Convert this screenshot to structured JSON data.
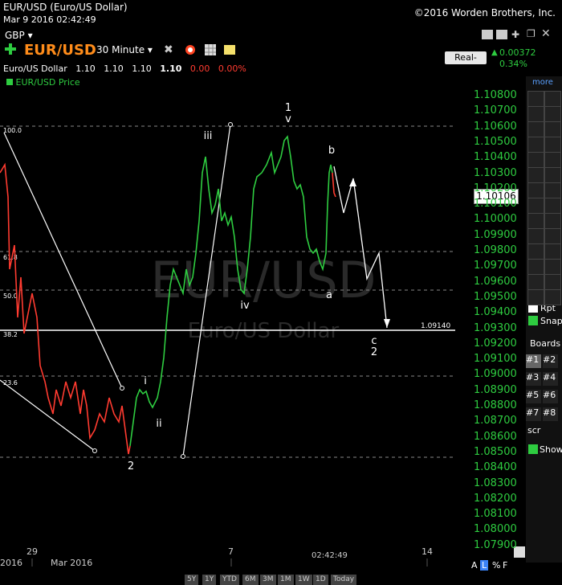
{
  "header": {
    "title": "EUR/USD (Euro/US Dollar)",
    "date": "Mar 9 2016 02:42:49",
    "copyright": "©2016 Worden Brothers, Inc.",
    "currency": "GBP"
  },
  "toolbar": {
    "symbol": "EUR/USD",
    "interval": "30 Minute",
    "icons": [
      "settings-icon",
      "clock-icon",
      "grid-icon",
      "note-icon"
    ],
    "realtime": "Real-Time",
    "change": "0.00372",
    "change_pct": "0.34%"
  },
  "quote": {
    "name": "Euro/US Dollar",
    "o": "1.10",
    "h": "1.10",
    "l": "1.10",
    "c": "1.10",
    "chg": "0.00",
    "pct": "0.00%"
  },
  "legend": {
    "price": "EUR/USD Price"
  },
  "watermark": {
    "symbol": "EUR/USD",
    "name": "Euro/US Dollar"
  },
  "fib_labels": [
    "100.0",
    "61.8",
    "50.0",
    "38.2",
    "23.6"
  ],
  "wave_labels": [
    "1",
    "v",
    "iii",
    "iv",
    "b",
    "a",
    "c",
    "2",
    "2",
    "i",
    "ii"
  ],
  "price_level": "1.09140",
  "current_price": "1.10106",
  "price_axis": [
    "1.10800",
    "1.10700",
    "1.10600",
    "1.10500",
    "1.10400",
    "1.10300",
    "1.10200",
    "1.10100",
    "1.10000",
    "1.09900",
    "1.09800",
    "1.09700",
    "1.09600",
    "1.09500",
    "1.09400",
    "1.09300",
    "1.09200",
    "1.09100",
    "1.09000",
    "1.08900",
    "1.08800",
    "1.08700",
    "1.08600",
    "1.08500",
    "1.08400",
    "1.08300",
    "1.08200",
    "1.08100",
    "1.08000",
    "1.07900"
  ],
  "x_axis": {
    "labels": [
      "2016",
      "29",
      "Mar 2016",
      "7",
      "02:42:49",
      "14"
    ]
  },
  "timeframes": [
    "5Y",
    "1Y",
    "YTD",
    "6M",
    "3M",
    "1M",
    "1W",
    "1D",
    "Today"
  ],
  "right_panel": {
    "more": "more",
    "rpt": "Rpt",
    "snap": "Snap",
    "boards": "Boards",
    "board_items": [
      "#1",
      "#2",
      "#3",
      "#4",
      "#5",
      "#6",
      "#7",
      "#8"
    ],
    "scr": "scr",
    "show": "Show"
  },
  "bottom_right": {
    "a": "A",
    "l": "L",
    "pct": "%",
    "f": "F"
  }
}
